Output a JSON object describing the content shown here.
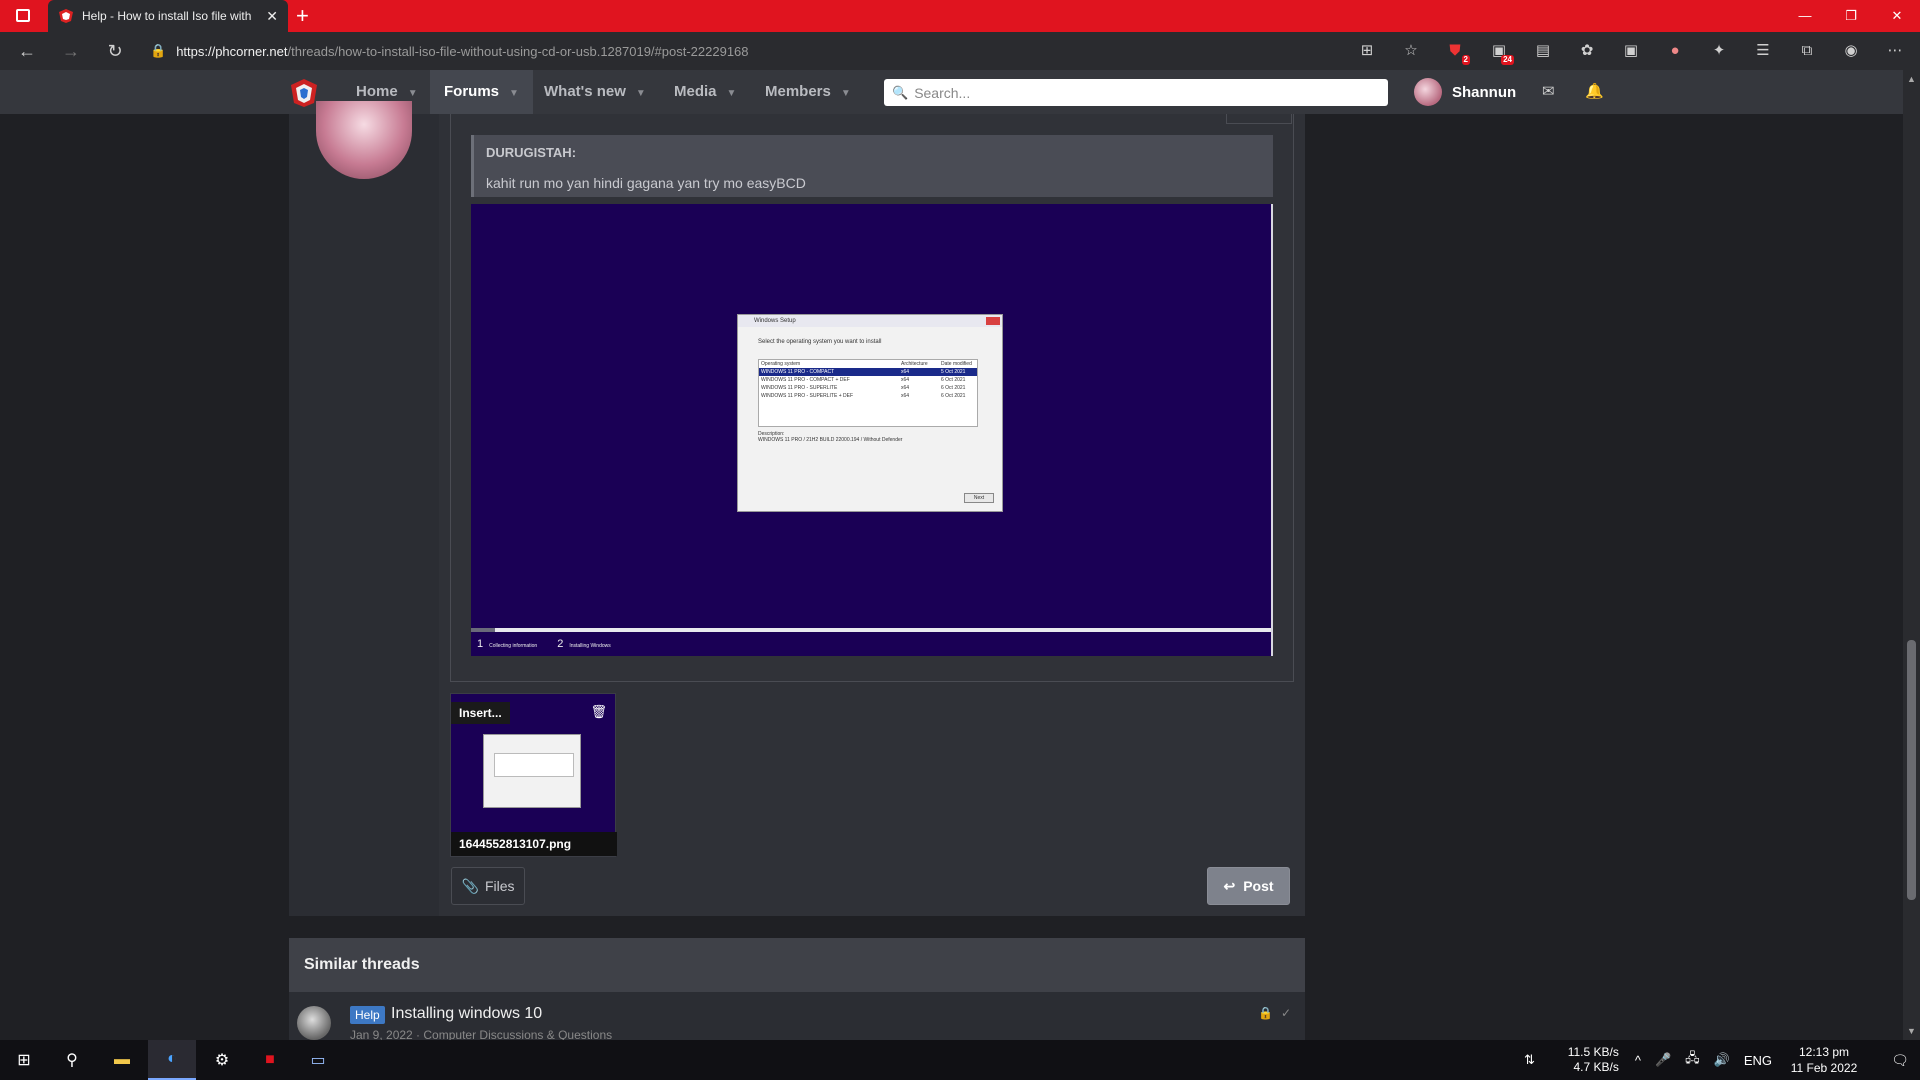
{
  "browser": {
    "tab_title": "Help - How to install Iso file with",
    "tab_close": "✕",
    "new_tab": "+",
    "url_host": "https://phcorner.net",
    "url_path": "/threads/how-to-install-iso-file-without-using-cd-or-usb.1287019/#post-22229168",
    "window_controls": {
      "minimize": "—",
      "restore": "❐",
      "close": "✕"
    },
    "extension_badges": {
      "ublock": "2",
      "ext2": "24"
    }
  },
  "site_nav": {
    "items": [
      {
        "label": "Home",
        "active": false
      },
      {
        "label": "Forums",
        "active": true
      },
      {
        "label": "What's new",
        "active": false
      },
      {
        "label": "Media",
        "active": false
      },
      {
        "label": "Members",
        "active": false
      }
    ],
    "search_placeholder": "Search...",
    "username": "Shannun"
  },
  "post": {
    "quote_author": "DURUGISTAH:",
    "quote_text": "kahit run mo yan hindi gagana yan try mo easyBCD",
    "setup_window": {
      "title": "Windows Setup",
      "instruction": "Select the operating system you want to install",
      "columns": [
        "Operating system",
        "Architecture",
        "Date modified"
      ],
      "rows": [
        [
          "WINDOWS 11 PRO - COMPACT",
          "x64",
          "5 Oct 2021"
        ],
        [
          "WINDOWS 11 PRO - COMPACT + DEF",
          "x64",
          "6 Oct 2021"
        ],
        [
          "WINDOWS 11 PRO - SUPERLITE",
          "x64",
          "6 Oct 2021"
        ],
        [
          "WINDOWS 11 PRO - SUPERLITE + DEF",
          "x64",
          "6 Oct 2021"
        ]
      ],
      "description_label": "Description:",
      "description": "WINDOWS 11 PRO / 21H2 BUILD 22000.194 / Without Defender",
      "next_button": "Next",
      "steps": [
        {
          "num": "1",
          "label": "Collecting information"
        },
        {
          "num": "2",
          "label": "Installing Windows"
        }
      ]
    },
    "attachment": {
      "insert_label": "Insert...",
      "filename": "1644552813107.png"
    },
    "files_button": "Files",
    "post_button": "Post"
  },
  "similar_threads": {
    "title": "Similar threads",
    "items": [
      {
        "prefix": "Help",
        "title": "Installing windows 10",
        "meta": "Jan 9, 2022 · Computer Discussions & Questions"
      }
    ]
  },
  "taskbar": {
    "net_down": "11.5 KB/s",
    "net_up": "4.7 KB/s",
    "lang": "ENG",
    "time": "12:13 pm",
    "date": "11 Feb 2022"
  },
  "colors": {
    "tabbar": "#e0141f",
    "site_header": "#35373d",
    "setup_bg": "#1a0055",
    "prefix_help": "#3d78c4"
  }
}
